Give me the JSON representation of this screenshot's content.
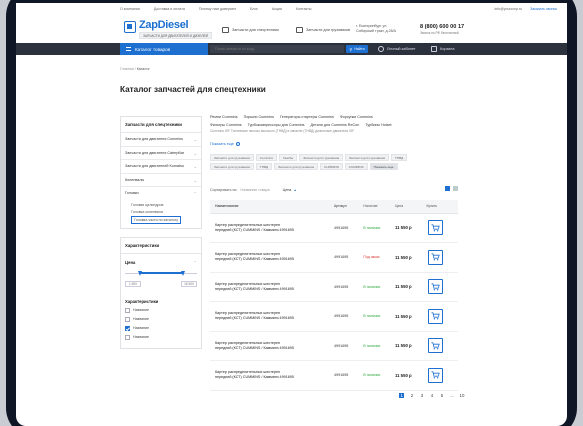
{
  "topbar": {
    "links": [
      "О компании",
      "Доставка и оплата",
      "Почему нам доверяют",
      "Блог",
      "Акции",
      "Контакты"
    ],
    "email": "info@yourcorp.ru",
    "callback": "Заказать звонок"
  },
  "header": {
    "logo": "ZapDiesel",
    "logo_tag": "ЗАПЧАСТИ ДЛЯ ДВИГАТЕЛЕЙ И ДИЗЕЛЕЙ",
    "link1": "Запчасти для спецтехники",
    "link2": "Запчасти для грузовиков",
    "city1": "г. Екатеринбург ул.",
    "city2": "Сибирский тракт, д.28/А",
    "phone": "8 (800) 600 00 17",
    "phone_note": "Звонок по РФ бесплатный"
  },
  "nav": {
    "catalog": "Каталог товаров",
    "search_placeholder": "Поиск запчасти по коду",
    "find": "Найти",
    "account": "Личный кабинет",
    "cart": "Корзина"
  },
  "breadcrumb": {
    "home": "Главная",
    "sep": "/",
    "current": "Каталог"
  },
  "page_title": "Каталог запчастей для спецтехники",
  "sidebar": {
    "header": "Запчасти для спецтехники",
    "groups": [
      {
        "label": "Запчасти для двигателя Cummins"
      },
      {
        "label": "Запчасти для двигателя Caterpillar"
      },
      {
        "label": "Запчасти для двигателей Komatsu"
      },
      {
        "label": "Коленвалы"
      },
      {
        "label": "Головки"
      }
    ],
    "subitems": [
      "Головки цилиндров",
      "Головка коленвала",
      "Головка части по каталогу"
    ]
  },
  "filters": {
    "header": "Характеристики",
    "price_label": "Цена",
    "min": "1 500",
    "max": "16 500",
    "char_label": "Характеристики",
    "options": [
      "Название",
      "Название",
      "Название",
      "Название"
    ]
  },
  "brands": {
    "row1": [
      "Ремни Cummins",
      "Поршни Cummins",
      "Генераторы стартеры Cummins",
      "Форсунки Cummins"
    ],
    "row2": [
      "Фильтры Cummins",
      "Турбокомпрессоры для Cummins",
      "Детали для Cummins ReCon",
      "Турбины Holset"
    ],
    "row3": "Cummins ISF  Топливные насосы высокого (ТНВД) в запасне (ТНВД) дизельные двигатели ISF",
    "more": "Показать еще"
  },
  "tags": [
    "Запчасти для грузовиков",
    "Cummins",
    "Газобы",
    "Запчасти для грузовиков",
    "Запчасти для грузовиков",
    "ТНВД",
    "Запчасти для грузовиков",
    "ТНВД",
    "Запчасти для грузовиков",
    "CUMMINS",
    "CUMMINS",
    "Показать еще"
  ],
  "sort": {
    "label": "Сортировать по:",
    "value": "Названию товара",
    "price": "Цена"
  },
  "table": {
    "headers": [
      "Наименование",
      "Артикул",
      "Наличие",
      "Цена",
      "Купить"
    ],
    "rows": [
      {
        "name1": "Картер распределительных шестерен",
        "name2": "передний (КСТ) CUMMINS / Камминз 4991695",
        "art": "4991695",
        "status": "В наличии",
        "stype": "ok",
        "price": "11 550 р"
      },
      {
        "name1": "Картер распределительных шестерен",
        "name2": "передний (КСТ) CUMMINS / Камминз 4991695",
        "art": "4991695",
        "status": "Под заказ",
        "stype": "ord",
        "price": "11 550 р"
      },
      {
        "name1": "Картер распределительных шестерен",
        "name2": "передний (КСТ) CUMMINS / Камминз 4991695",
        "art": "4991695",
        "status": "В наличии",
        "stype": "ok",
        "price": "11 550 р"
      },
      {
        "name1": "Картер распределительных шестерен",
        "name2": "передний (КСТ) CUMMINS / Камминз 4991695",
        "art": "4991695",
        "status": "В наличии",
        "stype": "ok",
        "price": "11 550 р"
      },
      {
        "name1": "Картер распределительных шестерен",
        "name2": "передний (КСТ) CUMMINS / Камминз 4991695",
        "art": "4991695",
        "status": "В наличии",
        "stype": "ok",
        "price": "11 550 р"
      },
      {
        "name1": "Картер распределительных шестерен",
        "name2": "передний (КСТ) CUMMINS / Камминз 4991695",
        "art": "4991695",
        "status": "В наличии",
        "stype": "ok",
        "price": "11 550 р"
      }
    ]
  },
  "pager": [
    "1",
    "2",
    "3",
    "4",
    "5",
    "...",
    "10"
  ],
  "colors": {
    "accent": "#1d6fd0",
    "nav": "#2c323d",
    "in_stock": "#2aa43a",
    "order": "#d9342b"
  }
}
